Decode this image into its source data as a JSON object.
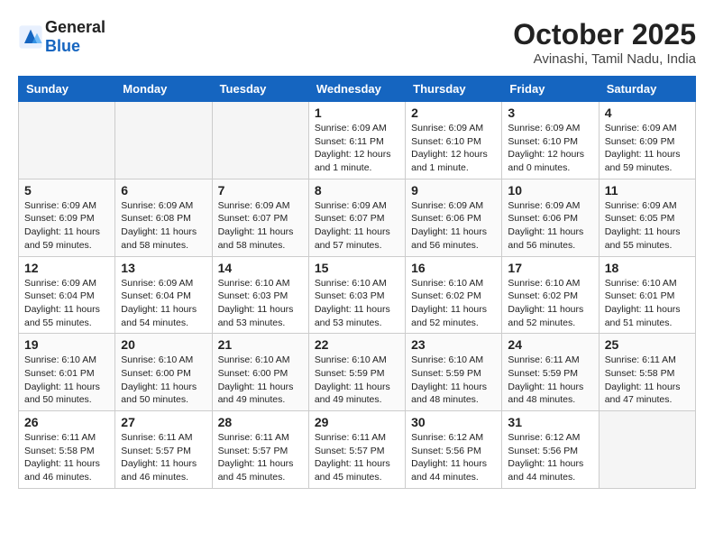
{
  "header": {
    "logo_general": "General",
    "logo_blue": "Blue",
    "month_title": "October 2025",
    "location": "Avinashi, Tamil Nadu, India"
  },
  "weekdays": [
    "Sunday",
    "Monday",
    "Tuesday",
    "Wednesday",
    "Thursday",
    "Friday",
    "Saturday"
  ],
  "weeks": [
    [
      {
        "day": "",
        "info": ""
      },
      {
        "day": "",
        "info": ""
      },
      {
        "day": "",
        "info": ""
      },
      {
        "day": "1",
        "info": "Sunrise: 6:09 AM\nSunset: 6:11 PM\nDaylight: 12 hours\nand 1 minute."
      },
      {
        "day": "2",
        "info": "Sunrise: 6:09 AM\nSunset: 6:10 PM\nDaylight: 12 hours\nand 1 minute."
      },
      {
        "day": "3",
        "info": "Sunrise: 6:09 AM\nSunset: 6:10 PM\nDaylight: 12 hours\nand 0 minutes."
      },
      {
        "day": "4",
        "info": "Sunrise: 6:09 AM\nSunset: 6:09 PM\nDaylight: 11 hours\nand 59 minutes."
      }
    ],
    [
      {
        "day": "5",
        "info": "Sunrise: 6:09 AM\nSunset: 6:09 PM\nDaylight: 11 hours\nand 59 minutes."
      },
      {
        "day": "6",
        "info": "Sunrise: 6:09 AM\nSunset: 6:08 PM\nDaylight: 11 hours\nand 58 minutes."
      },
      {
        "day": "7",
        "info": "Sunrise: 6:09 AM\nSunset: 6:07 PM\nDaylight: 11 hours\nand 58 minutes."
      },
      {
        "day": "8",
        "info": "Sunrise: 6:09 AM\nSunset: 6:07 PM\nDaylight: 11 hours\nand 57 minutes."
      },
      {
        "day": "9",
        "info": "Sunrise: 6:09 AM\nSunset: 6:06 PM\nDaylight: 11 hours\nand 56 minutes."
      },
      {
        "day": "10",
        "info": "Sunrise: 6:09 AM\nSunset: 6:06 PM\nDaylight: 11 hours\nand 56 minutes."
      },
      {
        "day": "11",
        "info": "Sunrise: 6:09 AM\nSunset: 6:05 PM\nDaylight: 11 hours\nand 55 minutes."
      }
    ],
    [
      {
        "day": "12",
        "info": "Sunrise: 6:09 AM\nSunset: 6:04 PM\nDaylight: 11 hours\nand 55 minutes."
      },
      {
        "day": "13",
        "info": "Sunrise: 6:09 AM\nSunset: 6:04 PM\nDaylight: 11 hours\nand 54 minutes."
      },
      {
        "day": "14",
        "info": "Sunrise: 6:10 AM\nSunset: 6:03 PM\nDaylight: 11 hours\nand 53 minutes."
      },
      {
        "day": "15",
        "info": "Sunrise: 6:10 AM\nSunset: 6:03 PM\nDaylight: 11 hours\nand 53 minutes."
      },
      {
        "day": "16",
        "info": "Sunrise: 6:10 AM\nSunset: 6:02 PM\nDaylight: 11 hours\nand 52 minutes."
      },
      {
        "day": "17",
        "info": "Sunrise: 6:10 AM\nSunset: 6:02 PM\nDaylight: 11 hours\nand 52 minutes."
      },
      {
        "day": "18",
        "info": "Sunrise: 6:10 AM\nSunset: 6:01 PM\nDaylight: 11 hours\nand 51 minutes."
      }
    ],
    [
      {
        "day": "19",
        "info": "Sunrise: 6:10 AM\nSunset: 6:01 PM\nDaylight: 11 hours\nand 50 minutes."
      },
      {
        "day": "20",
        "info": "Sunrise: 6:10 AM\nSunset: 6:00 PM\nDaylight: 11 hours\nand 50 minutes."
      },
      {
        "day": "21",
        "info": "Sunrise: 6:10 AM\nSunset: 6:00 PM\nDaylight: 11 hours\nand 49 minutes."
      },
      {
        "day": "22",
        "info": "Sunrise: 6:10 AM\nSunset: 5:59 PM\nDaylight: 11 hours\nand 49 minutes."
      },
      {
        "day": "23",
        "info": "Sunrise: 6:10 AM\nSunset: 5:59 PM\nDaylight: 11 hours\nand 48 minutes."
      },
      {
        "day": "24",
        "info": "Sunrise: 6:11 AM\nSunset: 5:59 PM\nDaylight: 11 hours\nand 48 minutes."
      },
      {
        "day": "25",
        "info": "Sunrise: 6:11 AM\nSunset: 5:58 PM\nDaylight: 11 hours\nand 47 minutes."
      }
    ],
    [
      {
        "day": "26",
        "info": "Sunrise: 6:11 AM\nSunset: 5:58 PM\nDaylight: 11 hours\nand 46 minutes."
      },
      {
        "day": "27",
        "info": "Sunrise: 6:11 AM\nSunset: 5:57 PM\nDaylight: 11 hours\nand 46 minutes."
      },
      {
        "day": "28",
        "info": "Sunrise: 6:11 AM\nSunset: 5:57 PM\nDaylight: 11 hours\nand 45 minutes."
      },
      {
        "day": "29",
        "info": "Sunrise: 6:11 AM\nSunset: 5:57 PM\nDaylight: 11 hours\nand 45 minutes."
      },
      {
        "day": "30",
        "info": "Sunrise: 6:12 AM\nSunset: 5:56 PM\nDaylight: 11 hours\nand 44 minutes."
      },
      {
        "day": "31",
        "info": "Sunrise: 6:12 AM\nSunset: 5:56 PM\nDaylight: 11 hours\nand 44 minutes."
      },
      {
        "day": "",
        "info": ""
      }
    ]
  ]
}
